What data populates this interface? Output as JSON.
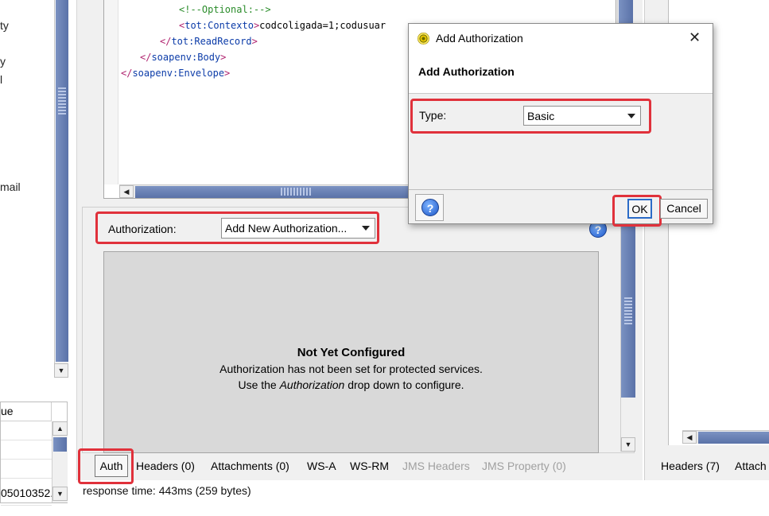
{
  "left_panel": {
    "fragments": [
      "ty",
      "y",
      "l",
      "mail"
    ],
    "table": {
      "header": "ue",
      "rows": [
        "",
        "",
        "",
        "05010352..."
      ]
    }
  },
  "editor": {
    "lines": [
      {
        "parts": [
          {
            "cls": "c-comment",
            "t": "<!--Optional:-->"
          }
        ]
      },
      {
        "parts": [
          {
            "cls": "c-tag",
            "t": "<"
          },
          {
            "cls": "c-ns",
            "t": "tot:Contexto"
          },
          {
            "cls": "c-tag",
            "t": ">"
          },
          {
            "cls": "c-text",
            "t": "codcoligada=1;codusuar"
          }
        ]
      },
      {
        "parts": [
          {
            "cls": "c-tag",
            "t": "</"
          },
          {
            "cls": "c-ns",
            "t": "tot:ReadRecord"
          },
          {
            "cls": "c-tag",
            "t": ">"
          }
        ]
      },
      {
        "parts": [
          {
            "cls": "c-tag",
            "t": "</"
          },
          {
            "cls": "c-ns",
            "t": "soapenv:Body"
          },
          {
            "cls": "c-tag",
            "t": ">"
          }
        ]
      },
      {
        "parts": [
          {
            "cls": "c-tag",
            "t": "</"
          },
          {
            "cls": "c-ns",
            "t": "soapenv:Envelope"
          },
          {
            "cls": "c-tag",
            "t": ">"
          }
        ]
      }
    ]
  },
  "authorization": {
    "label": "Authorization:",
    "selected": "Add New Authorization...",
    "empty_title": "Not Yet Configured",
    "empty_line1": "Authorization has not been set for protected services.",
    "empty_line2_pre": "Use the ",
    "empty_line2_em": "Authorization",
    "empty_line2_post": " drop down to configure."
  },
  "tabs": {
    "auth": "Auth",
    "headers": "Headers (0)",
    "attachments": "Attachments (0)",
    "ws_a": "WS-A",
    "ws_rm": "WS-RM",
    "jms_headers": "JMS Headers",
    "jms_property": "JMS Property (0)"
  },
  "status": {
    "response": "response time: 443ms (259 bytes)"
  },
  "right_panel": {
    "headers": "Headers (7)",
    "attach": "Attach"
  },
  "dialog": {
    "title": "Add Authorization",
    "heading": "Add Authorization",
    "type_label": "Type:",
    "type_value": "Basic",
    "ok": "OK",
    "cancel": "Cancel",
    "close_glyph": "✕",
    "help_glyph": "?"
  },
  "colors": {
    "highlight": "#e0313b",
    "scrollbar": "#6a82b8",
    "config_bg": "#d9d9d9"
  },
  "icons": [
    "help-icon",
    "close-icon",
    "auth-app-icon",
    "dropdown-caret-icon"
  ]
}
